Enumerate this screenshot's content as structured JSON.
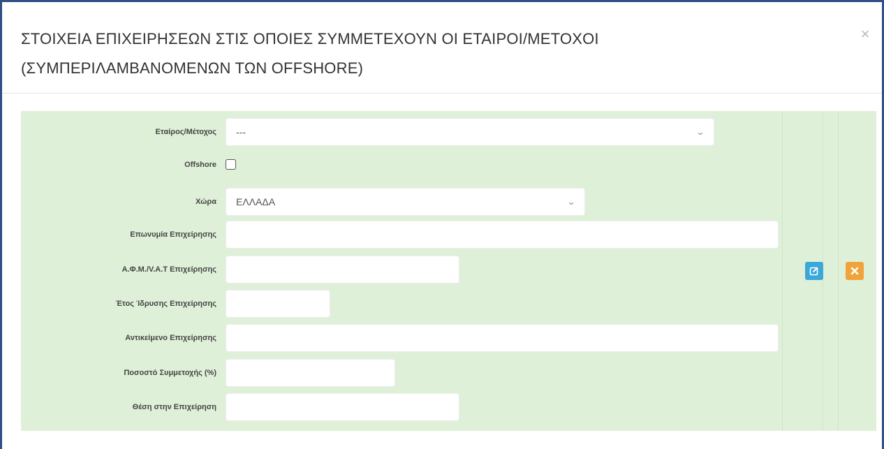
{
  "modal": {
    "title": "ΣΤΟΙΧΕΙΑ ΕΠΙΧΕΙΡΗΣΕΩΝ ΣΤΙΣ ΟΠΟΙΕΣ ΣΥΜΜΕΤΕΧΟΥΝ ΟΙ ΕΤΑΙΡΟΙ/ΜΕΤΟΧΟΙ (ΣΥΜΠΕΡΙΛΑΜΒΑΝΟΜΕΝΩΝ ΤΩΝ OFFSHORE)",
    "close_label": "×"
  },
  "form": {
    "partner": {
      "label": "Εταίρος/Μέτοχος",
      "value": "---"
    },
    "offshore": {
      "label": "Offshore",
      "checked": false
    },
    "country": {
      "label": "Χώρα",
      "value": "ΕΛΛΑΔΑ"
    },
    "company_name": {
      "label": "Επωνυμία Επιχείρησης",
      "value": ""
    },
    "tax_id": {
      "label": "Α.Φ.Μ./V.A.T Επιχείρησης",
      "value": ""
    },
    "founding_year": {
      "label": "Έτος Ίδρυσης Επιχείρησης",
      "value": ""
    },
    "business_object": {
      "label": "Αντικείμενο Επιχείρησης",
      "value": ""
    },
    "participation": {
      "label": "Ποσοστό Συμμετοχής (%)",
      "value": ""
    },
    "position": {
      "label": "Θέση στην Επιχείρηση",
      "value": ""
    }
  },
  "actions": {
    "edit_icon": "edit-icon",
    "delete_icon": "times-icon",
    "edit_color": "#3aa8d8",
    "delete_color": "#f0a33a"
  }
}
